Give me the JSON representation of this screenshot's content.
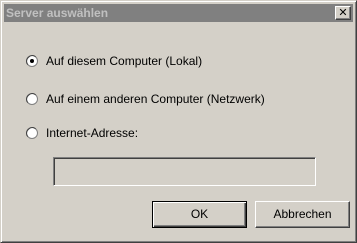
{
  "dialog": {
    "title": "Server auswählen",
    "close_glyph": "✕"
  },
  "options": [
    {
      "label": "Auf diesem Computer (Lokal)",
      "selected": true
    },
    {
      "label": "Auf einem anderen Computer (Netzwerk)",
      "selected": false
    },
    {
      "label": "Internet-Adresse:",
      "selected": false
    }
  ],
  "internet_address": {
    "value": "",
    "enabled": false
  },
  "buttons": {
    "ok_label": "OK",
    "cancel_label": "Abbrechen"
  },
  "icons": {
    "close": "close-icon",
    "radio_selected": "radio-selected-icon",
    "radio_unselected": "radio-unselected-icon"
  },
  "colors": {
    "dialog_face": "#d4d0c8",
    "inactive_titlebar": "#808080",
    "inactive_title_text": "#c0c0c0"
  }
}
